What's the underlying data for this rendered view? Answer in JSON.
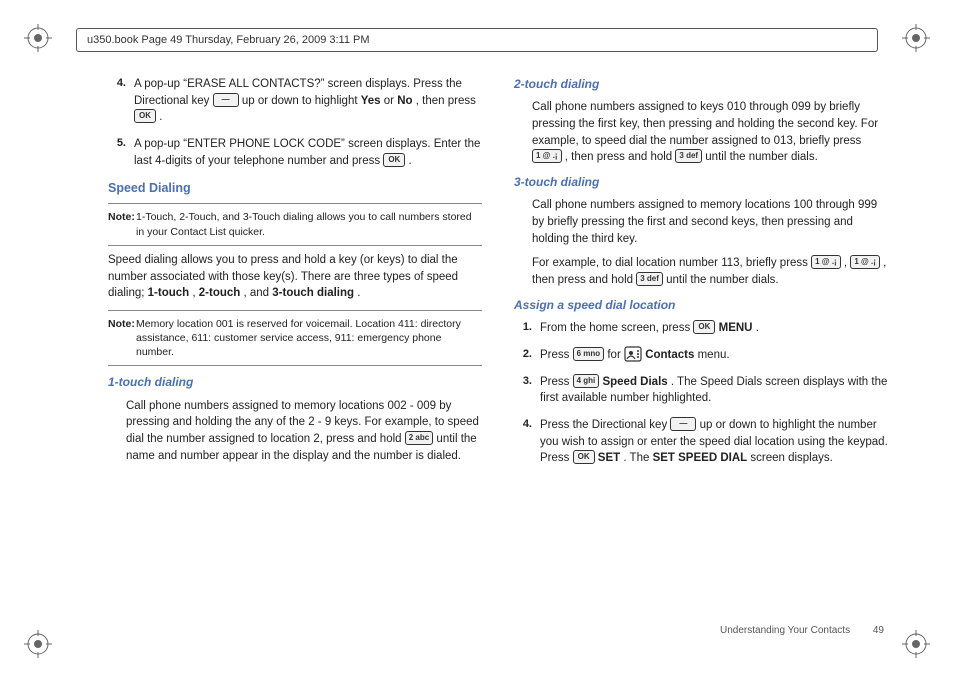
{
  "header": "u350.book  Page 49  Thursday, February 26, 2009  3:11 PM",
  "left": {
    "step4_a": "A pop-up “ERASE ALL CONTACTS?” screen displays. Press the Directional key ",
    "step4_b": " up or down to highlight ",
    "yes": "Yes",
    "or": " or ",
    "no": "No",
    "step4_c": ", then press ",
    "period": ".",
    "step5_a": "A pop-up “ENTER PHONE LOCK CODE” screen displays. Enter the last 4-digits of your telephone number and press ",
    "speed_dialing": "Speed Dialing",
    "note1_label": "Note:",
    "note1_body": "1-Touch, 2-Touch, and 3-Touch dialing allows you to call numbers stored in your Contact List quicker.",
    "para1_a": "Speed dialing allows you to press and hold a key (or keys) to dial the number associated with those key(s). There are three types of speed dialing; ",
    "touch1": "1-touch",
    "c1": ", ",
    "touch2": "2-touch",
    "c2": ", and ",
    "touch3": "3-touch dialing",
    "note2_label": "Note:",
    "note2_body": "Memory location 001 is reserved for voicemail. Location 411: directory assistance, 611: customer service access, 911: emergency phone number.",
    "h_1touch": "1-touch dialing",
    "para2_a": "Call phone numbers assigned to memory locations 002 - 009 by pressing and holding the any of the 2 - 9 keys. For example, to speed dial the number assigned to location 2, press and hold ",
    "para2_b": " until the name and number appear in the display and the number is dialed."
  },
  "right": {
    "h_2touch": "2-touch dialing",
    "para3_a": "Call phone numbers assigned to keys 010 through 099 by briefly pressing the first key, then pressing and holding the second key. For example, to speed dial the number assigned to 013, briefly press ",
    "para3_b": ", then press and hold ",
    "para3_c": " until the number dials.",
    "h_3touch": "3-touch dialing",
    "para4": "Call phone numbers assigned to memory locations 100 through 999 by briefly pressing the first and second keys, then pressing and holding the third key.",
    "para5_a": "For example, to dial location number 113, briefly press ",
    "para5_b": ", ",
    "para5_c": ", then press and hold ",
    "para5_d": " until the number dials.",
    "h_assign": "Assign a speed dial location",
    "s1_a": "From the home screen, press ",
    "s1_b": " ",
    "menu": "MENU",
    "s2_a": "Press ",
    "s2_b": " for ",
    "s2_c": " ",
    "contacts": "Contacts",
    "s2_d": " menu.",
    "s3_a": "Press ",
    "s3_b": " ",
    "speeddials": "Speed Dials",
    "s3_c": ". The Speed Dials screen displays with the first available number highlighted.",
    "s4_a": "Press the Directional key ",
    "s4_b": " up or down to highlight the number you wish to assign or enter the speed dial location using the keypad. Press ",
    "s4_c": " ",
    "set": "SET",
    "s4_d": ". The ",
    "setspeed": "SET SPEED DIAL",
    "s4_e": " screen displays."
  },
  "keys": {
    "ok": "OK",
    "dir": "—",
    "k1": "1 @ .¡",
    "k2": "2 abc",
    "k3": "3 def",
    "k4": "4 ghi",
    "k6": "6 mno"
  },
  "nums": {
    "n1": "1.",
    "n2": "2.",
    "n3": "3.",
    "n4": "4.",
    "n5": "5."
  },
  "footer": {
    "section": "Understanding Your Contacts",
    "page": "49"
  }
}
